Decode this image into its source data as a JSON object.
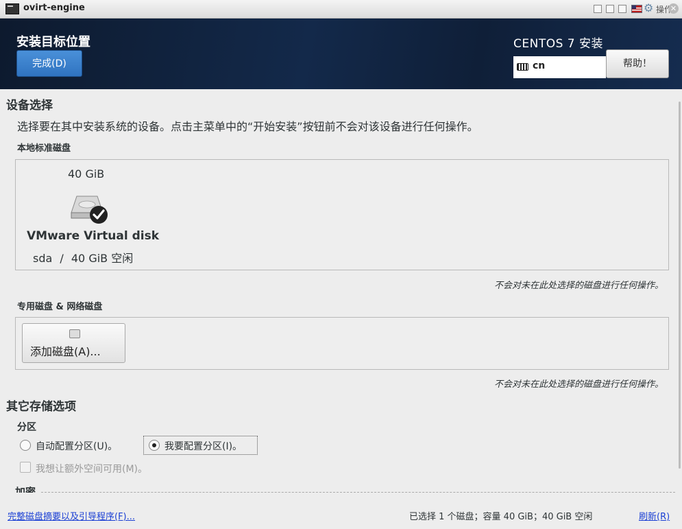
{
  "window": {
    "title": "ovirt-engine",
    "ops_label": "操作"
  },
  "header": {
    "page_title": "安装目标位置",
    "done_button": "完成(D)",
    "product_title": "CENTOS 7 安装",
    "keyboard_layout": "cn",
    "help_button": "帮助！"
  },
  "device_selection": {
    "title": "设备选择",
    "description": "选择要在其中安装系统的设备。点击主菜单中的“开始安装”按钮前不会对该设备进行任何操作。",
    "local_disks_title": "本地标准磁盘",
    "disk": {
      "size": "40 GiB",
      "name": "VMware Virtual disk",
      "device": "sda",
      "separator": "/",
      "free": "40 GiB 空闲",
      "selected": true
    },
    "local_note": "不会对未在此处选择的磁盘进行任何操作。",
    "specialized_title": "专用磁盘 & 网络磁盘",
    "add_disk_button": "添加磁盘(A)...",
    "specialized_note": "不会对未在此处选择的磁盘进行任何操作。"
  },
  "other_storage": {
    "title": "其它存储选项",
    "partition_title": "分区",
    "auto_partition": "自动配置分区(U)。",
    "manual_partition": "我要配置分区(I)。",
    "selected_partition": "manual",
    "extra_space": "我想让额外空间可用(M)。",
    "encryption_title": "加密"
  },
  "footer": {
    "summary_link": "完整磁盘摘要以及引导程序(F)...",
    "status": "已选择 1 个磁盘；容量 40 GiB；40 GiB 空闲",
    "refresh_link": "刷新(R)"
  }
}
